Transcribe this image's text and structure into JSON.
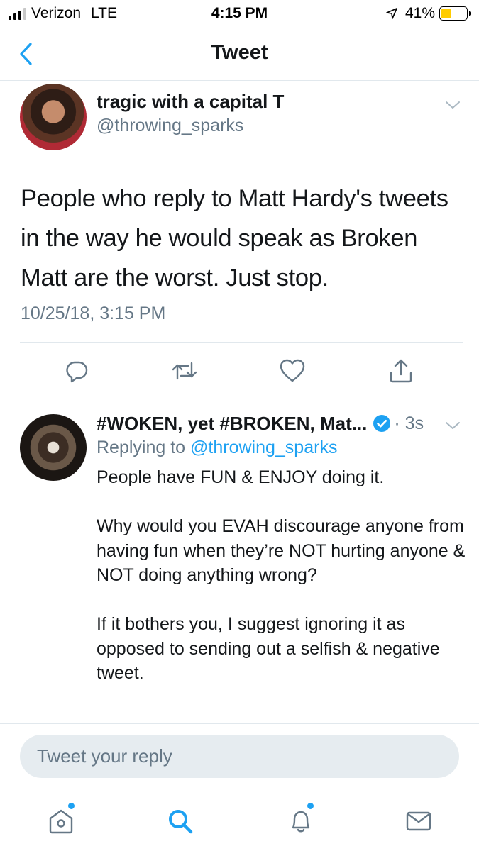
{
  "status_bar": {
    "carrier": "Verizon",
    "network": "LTE",
    "time": "4:15 PM",
    "battery": "41%",
    "battery_level": 0.41,
    "battery_color": "#ffcc00",
    "signal_bars": 3
  },
  "nav": {
    "title": "Tweet",
    "back_icon": "chevron-left-icon"
  },
  "tweet": {
    "author_name": "tragic with a capital T",
    "author_handle": "@throwing_sparks",
    "text": "People who reply to Matt Hardy's tweets in the way he would speak as Broken Matt are the worst. Just stop.",
    "timestamp": "10/25/18, 3:15 PM",
    "actions": [
      "reply-icon",
      "retweet-icon",
      "like-icon",
      "share-icon"
    ]
  },
  "reply": {
    "author_name": "#WOKEN, yet #BROKEN, Mat...",
    "verified": true,
    "time": "· 3s",
    "replying_prefix": "Replying to",
    "replying_handle": "@throwing_sparks",
    "paragraphs": [
      "People have FUN & ENJOY doing it.",
      "Why would you EVAH discourage anyone from having fun when they’re NOT hurting anyone & NOT doing anything wrong?",
      "If it bothers you, I suggest ignoring it as opposed to sending out a selfish & negative tweet."
    ]
  },
  "compose": {
    "placeholder": "Tweet your reply"
  },
  "tab_bar": {
    "items": [
      "home-icon",
      "search-icon",
      "notifications-icon",
      "messages-icon"
    ],
    "active": "search-icon"
  },
  "colors": {
    "accent": "#1da1f2",
    "text": "#14171a",
    "secondary": "#657786",
    "divider": "#e1e8ed",
    "compose_bg": "#e6ecf0"
  }
}
